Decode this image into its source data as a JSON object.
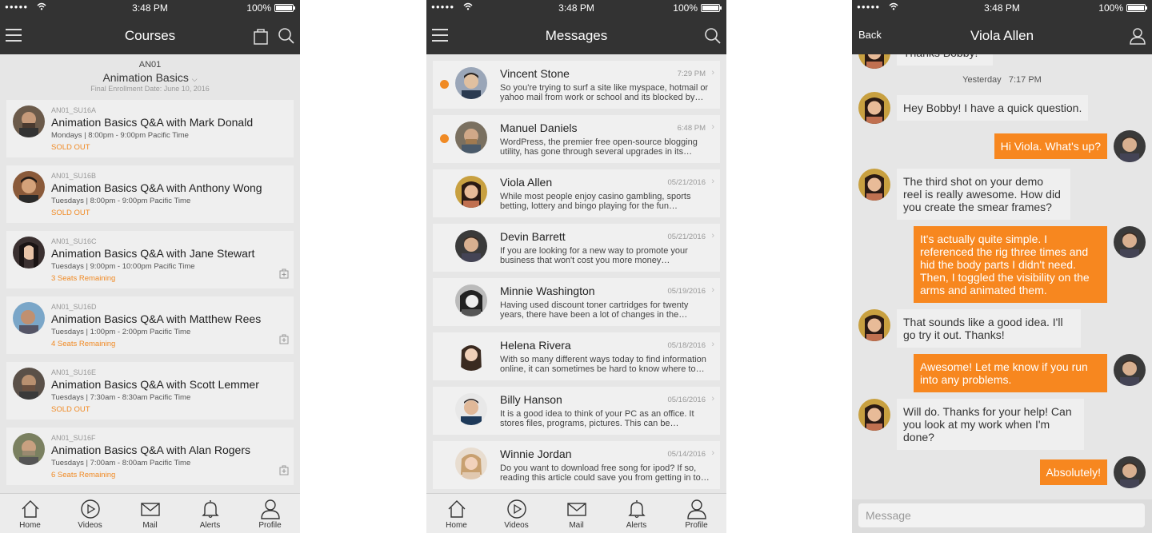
{
  "colors": {
    "accent": "#f7871f",
    "header": "#333333",
    "background": "#e6e6e6"
  },
  "status_bar": {
    "time": "3:48 PM",
    "battery": "100%"
  },
  "tabbar": [
    {
      "label": "Home",
      "icon": "home-icon"
    },
    {
      "label": "Videos",
      "icon": "play-icon"
    },
    {
      "label": "Mail",
      "icon": "mail-icon"
    },
    {
      "label": "Alerts",
      "icon": "bell-icon"
    },
    {
      "label": "Profile",
      "icon": "profile-icon"
    }
  ],
  "courses_screen": {
    "title": "Courses",
    "course_code": "AN01",
    "course_name": "Animation Basics",
    "enrollment_date": "Final Enrollment Date: June 10, 2016",
    "items": [
      {
        "code": "AN01_SU16A",
        "title": "Animation Basics Q&A with Mark Donald",
        "time": "Mondays | 8:00pm - 9:00pm Pacific Time",
        "status": "SOLD OUT",
        "has_bag": false
      },
      {
        "code": "AN01_SU16B",
        "title": "Animation Basics Q&A with Anthony Wong",
        "time": "Tuesdays | 8:00pm - 9:00pm Pacific Time",
        "status": "SOLD OUT",
        "has_bag": false
      },
      {
        "code": "AN01_SU16C",
        "title": "Animation Basics Q&A with Jane Stewart",
        "time": "Tuesdays | 9:00pm - 10:00pm Pacific Time",
        "status": "3 Seats Remaining",
        "has_bag": true
      },
      {
        "code": "AN01_SU16D",
        "title": "Animation Basics Q&A with Matthew Rees",
        "time": "Tuesdays | 1:00pm - 2:00pm Pacific Time",
        "status": "4 Seats Remaining",
        "has_bag": true
      },
      {
        "code": "AN01_SU16E",
        "title": "Animation Basics Q&A with Scott Lemmer",
        "time": "Tuesdays | 7:30am - 8:30am Pacific Time",
        "status": "SOLD OUT",
        "has_bag": false
      },
      {
        "code": "AN01_SU16F",
        "title": "Animation Basics Q&A with Alan Rogers",
        "time": "Tuesdays | 7:00am - 8:00am Pacific Time",
        "status": "6 Seats Remaining",
        "has_bag": true
      }
    ]
  },
  "messages_screen": {
    "title": "Messages",
    "items": [
      {
        "name": "Vincent Stone",
        "date": "7:29 PM",
        "unread": true,
        "preview": "So you're trying to surf a site like myspace, hotmail or yahoo mail from work or school and its blocked by…"
      },
      {
        "name": "Manuel Daniels",
        "date": "6:48 PM",
        "unread": true,
        "preview": "WordPress, the premier free open-source blogging utility, has gone through several upgrades in its…"
      },
      {
        "name": "Viola Allen",
        "date": "05/21/2016",
        "unread": false,
        "preview": "While most people enjoy casino gambling, sports betting, lottery and bingo playing for the fun…"
      },
      {
        "name": "Devin Barrett",
        "date": "05/21/2016",
        "unread": false,
        "preview": "If you are looking for a new way to promote your business that won't cost you more money…"
      },
      {
        "name": "Minnie Washington",
        "date": "05/19/2016",
        "unread": false,
        "preview": "Having used discount toner cartridges for twenty years, there have been a lot of changes in the…"
      },
      {
        "name": "Helena Rivera",
        "date": "05/18/2016",
        "unread": false,
        "preview": "With so many different ways today to find information online, it can sometimes be hard to know where to…"
      },
      {
        "name": "Billy Hanson",
        "date": "05/16/2016",
        "unread": false,
        "preview": "It is a good idea to think of your PC as an office. It stores files, programs, pictures. This can be…"
      },
      {
        "name": "Winnie Jordan",
        "date": "05/14/2016",
        "unread": false,
        "preview": "Do you want to download free song for ipod? If so, reading this article could save you from getting in to…"
      }
    ]
  },
  "chat_screen": {
    "back_label": "Back",
    "title": "Viola Allen",
    "timestamp_day": "Yesterday",
    "timestamp_time": "7:17 PM",
    "previous_message": "Thanks Bobby!",
    "messages": [
      {
        "from": "in",
        "text": "Hey Bobby! I have a quick question."
      },
      {
        "from": "out",
        "text": "Hi Viola. What's up?"
      },
      {
        "from": "in",
        "text": "The third shot on your demo reel is really awesome. How did you create the smear frames?"
      },
      {
        "from": "out",
        "text": "It's actually quite simple. I referenced the rig three times and hid the body parts I didn't need. Then, I toggled the visibility on the arms and animated them."
      },
      {
        "from": "in",
        "text": "That sounds like a good idea. I'll go try it out. Thanks!"
      },
      {
        "from": "out",
        "text": "Awesome! Let me know if you run into any problems."
      },
      {
        "from": "in",
        "text": "Will do. Thanks for your help! Can you look at my work when I'm done?"
      },
      {
        "from": "out",
        "text": "Absolutely!"
      }
    ],
    "input_placeholder": "Message"
  }
}
